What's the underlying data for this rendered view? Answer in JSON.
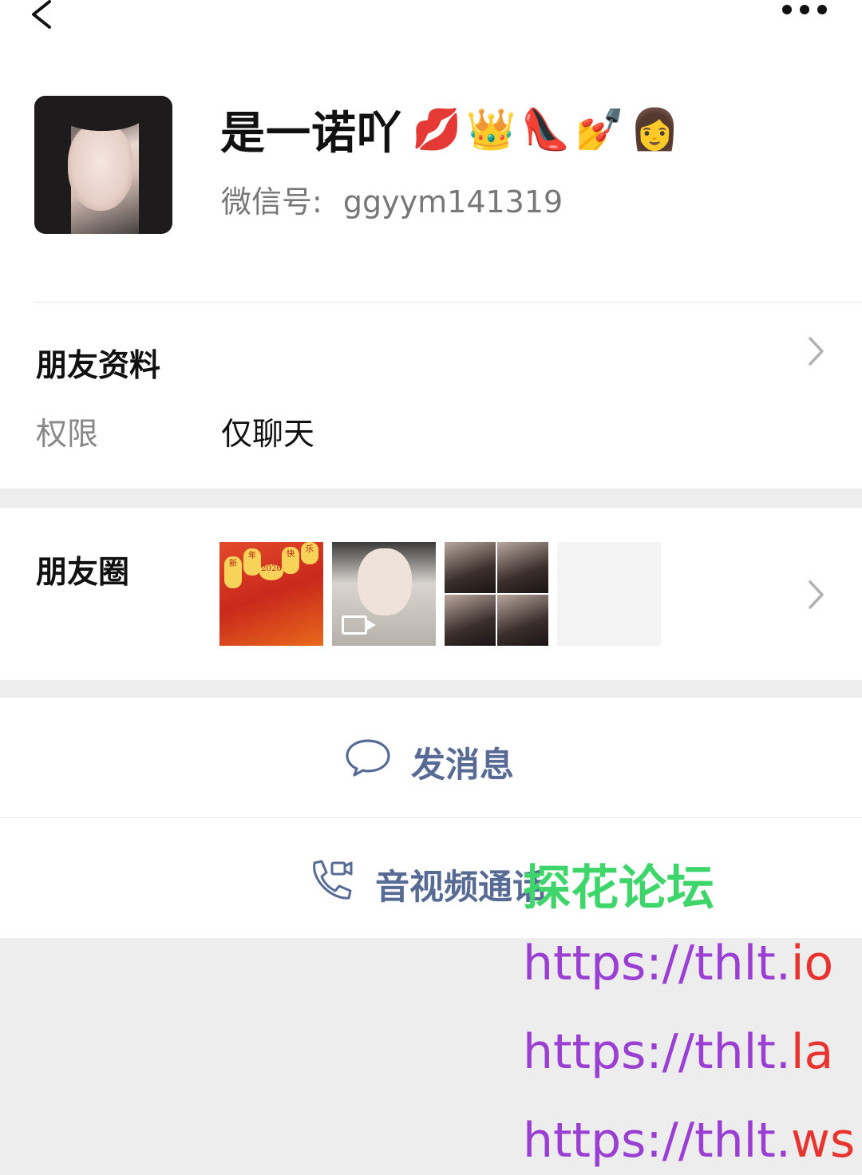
{
  "profile": {
    "name": "是一诺吖",
    "emojis": "💋👑👠💅👩",
    "wechat_id_label": "微信号:",
    "wechat_id": "ggyym141319"
  },
  "friend_info": {
    "title": "朋友资料",
    "permission_label": "权限",
    "permission_value": "仅聊天"
  },
  "moments": {
    "title": "朋友圈",
    "thumb1_text": [
      "新",
      "年",
      "快",
      "乐",
      "2026"
    ]
  },
  "actions": {
    "message_label": "发消息",
    "call_label": "音视频通话"
  },
  "watermark": {
    "forum": "探花论坛",
    "links": [
      {
        "prefix": "https://thlt.",
        "tld": "io"
      },
      {
        "prefix": "https://thlt.",
        "tld": "la"
      },
      {
        "prefix": "https://thlt.",
        "tld": "ws"
      }
    ]
  },
  "colors": {
    "link_blue": "#576b95",
    "watermark_green": "#3ed66b",
    "watermark_purple": "#9b3fd4",
    "watermark_red": "#e8332f"
  }
}
